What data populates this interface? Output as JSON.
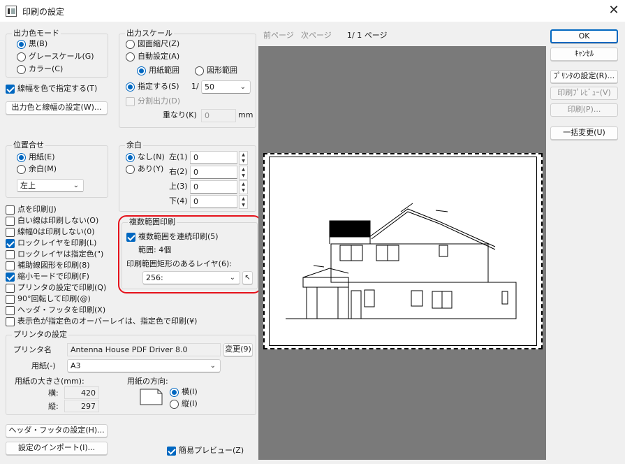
{
  "window": {
    "title": "印刷の設定",
    "close_glyph": "✕"
  },
  "output_color": {
    "title": "出力色モード",
    "options": [
      {
        "label": "黒(B)",
        "checked": true
      },
      {
        "label": "グレースケール(G)",
        "checked": false
      },
      {
        "label": "カラー(C)",
        "checked": false
      }
    ]
  },
  "line_width_color": {
    "label": "線幅を色で指定する(T)",
    "checked": true
  },
  "output_color_width_button": "出力色と線幅の設定(W)...",
  "output_scale": {
    "title": "出力スケール",
    "drawing_scale": "図面縮尺(Z)",
    "auto": "自動設定(A)",
    "paper_range": "用紙範囲",
    "figure_range": "図形範囲",
    "specify": "指定する(S)",
    "ratio_prefix": "1/",
    "ratio_value": "50",
    "split_output": "分割出力(D)",
    "overlap_label": "重なり(K)",
    "overlap_value": "0",
    "overlap_unit": "mm"
  },
  "position": {
    "title": "位置合せ",
    "options": [
      {
        "label": "用紙(E)",
        "checked": true
      },
      {
        "label": "余白(M)",
        "checked": false
      }
    ],
    "align_value": "左上"
  },
  "margin": {
    "title": "余白",
    "none": "なし(N)",
    "some": "あり(Y)",
    "fields": [
      {
        "label": "左(1)",
        "value": "0"
      },
      {
        "label": "右(2)",
        "value": "0"
      },
      {
        "label": "上(3)",
        "value": "0"
      },
      {
        "label": "下(4)",
        "value": "0"
      }
    ]
  },
  "print_options": [
    {
      "label": "点を印刷(J)",
      "checked": false
    },
    {
      "label": "白い線は印刷しない(O)",
      "checked": false
    },
    {
      "label": "線幅0は印刷しない(0)",
      "checked": false
    },
    {
      "label": "ロックレイヤを印刷(L)",
      "checked": true
    },
    {
      "label": "ロックレイヤは指定色(\")",
      "checked": false
    },
    {
      "label": "補助線図形を印刷(8)",
      "checked": false
    },
    {
      "label": "縮小モードで印刷(F)",
      "checked": true
    },
    {
      "label": "プリンタの設定で印刷(Q)",
      "checked": false
    },
    {
      "label": "90°回転して印刷(@)",
      "checked": false
    },
    {
      "label": "ヘッダ・フッタを印刷(X)",
      "checked": false
    },
    {
      "label": "表示色が指定色のオーバーレイは、指定色で印刷(¥)",
      "checked": false
    }
  ],
  "multi_range": {
    "title": "複数範囲印刷",
    "continuous": "複数範囲を連続印刷(5)",
    "range_count": "範囲: 4個",
    "layer_label": "印刷範囲矩形のあるレイヤ(6):",
    "layer_value": "256:"
  },
  "printer": {
    "title": "プリンタの設定",
    "name_label": "プリンタ名",
    "name_value": "Antenna House PDF Driver 8.0",
    "change_button": "変更(9)",
    "paper_label": "用紙(-)",
    "paper_value": "A3",
    "size_label": "用紙の大きさ(mm):",
    "width_label": "横:",
    "width_value": "420",
    "height_label": "縦:",
    "height_value": "297",
    "orientation_label": "用紙の方向:",
    "landscape": "横(I)",
    "portrait": "縦(I)"
  },
  "header_footer_button": "ヘッダ・フッタの設定(H)...",
  "import_button": "設定のインポート(I)...",
  "simple_preview": {
    "label": "簡易プレビュー(Z)",
    "checked": true
  },
  "nav": {
    "prev": "前ページ",
    "next": "次ページ",
    "page": "1/  1 ページ"
  },
  "right_buttons": {
    "ok": "OK",
    "cancel": "ｷｬﾝｾﾙ",
    "printer_settings": "ﾌﾟﾘﾝﾀの設定(R)...",
    "print_preview": "印刷ﾌﾟﾚﾋﾞｭｰ(V)",
    "print": "印刷(P)...",
    "batch_change": "一括変更(U)"
  },
  "colors": {
    "accent": "#0067c0",
    "highlight": "#e5121b",
    "preview_bg": "#7a7a7a"
  }
}
